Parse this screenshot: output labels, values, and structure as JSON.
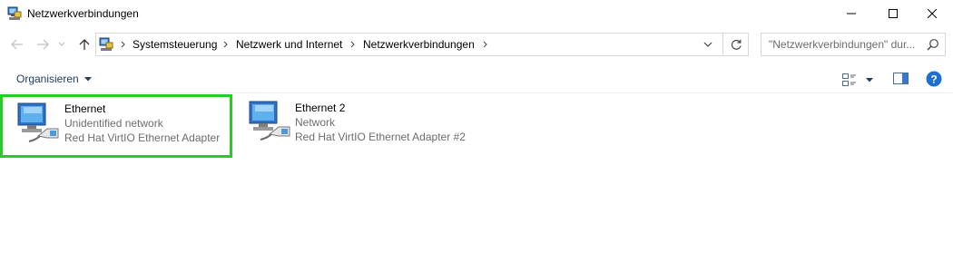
{
  "window": {
    "title": "Netzwerkverbindungen",
    "controls": [
      "minimize-icon",
      "maximize-icon",
      "close-icon"
    ]
  },
  "nav": {
    "breadcrumb": [
      "Systemsteuerung",
      "Netzwerk und Internet",
      "Netzwerkverbindungen"
    ],
    "search_placeholder": "\"Netzwerkverbindungen\" dur..."
  },
  "toolbar": {
    "organize_label": "Organisieren"
  },
  "colors": {
    "selection_border": "#2dc82a",
    "link_blue": "#1f3d66",
    "secondary_text": "#6d6d6d",
    "help_blue": "#1e6fd1"
  },
  "connections": [
    {
      "name": "Ethernet",
      "status": "Unidentified network",
      "adapter": "Red Hat VirtIO Ethernet Adapter",
      "selected": true
    },
    {
      "name": "Ethernet 2",
      "status": "Network",
      "adapter": "Red Hat VirtIO Ethernet Adapter #2",
      "selected": false
    }
  ]
}
